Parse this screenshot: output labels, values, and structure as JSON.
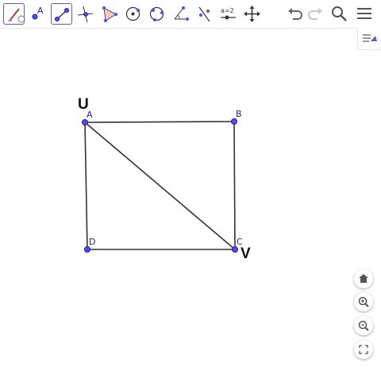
{
  "toolbar": {
    "tools": [
      {
        "name": "pen-tool",
        "selected": true
      },
      {
        "name": "point-tool",
        "label": "A",
        "selected": false
      },
      {
        "name": "segment-tool",
        "selected": true
      },
      {
        "name": "perpendicular-line-tool",
        "selected": false
      },
      {
        "name": "polygon-tool",
        "selected": false
      },
      {
        "name": "circle-center-point-tool",
        "selected": false
      },
      {
        "name": "circle-three-points-tool",
        "selected": false
      },
      {
        "name": "angle-tool",
        "selected": false
      },
      {
        "name": "reflect-tool",
        "selected": false
      },
      {
        "name": "slider-tool",
        "label": "a=2",
        "selected": false
      },
      {
        "name": "move-graphics-view-tool",
        "selected": false
      }
    ],
    "slider_label": "a=2",
    "point_label": "A"
  },
  "geometry": {
    "points": [
      {
        "name": "A",
        "label": "A"
      },
      {
        "name": "B",
        "label": "B"
      },
      {
        "name": "C",
        "label": "C"
      },
      {
        "name": "D",
        "label": "D"
      }
    ],
    "segments": [
      "AB",
      "BC",
      "CD",
      "DA",
      "AC"
    ],
    "handwritten": {
      "top_left": "U",
      "bottom_right": "V"
    }
  },
  "colors": {
    "accent": "#6557d2",
    "point_fill": "#4d4dff",
    "point_stroke": "#1a1a99",
    "segment": "#333333",
    "label": "#1b1bb0"
  },
  "zoom_controls": [
    "home-icon",
    "zoom-in-icon",
    "zoom-out-icon",
    "fullscreen-icon"
  ]
}
